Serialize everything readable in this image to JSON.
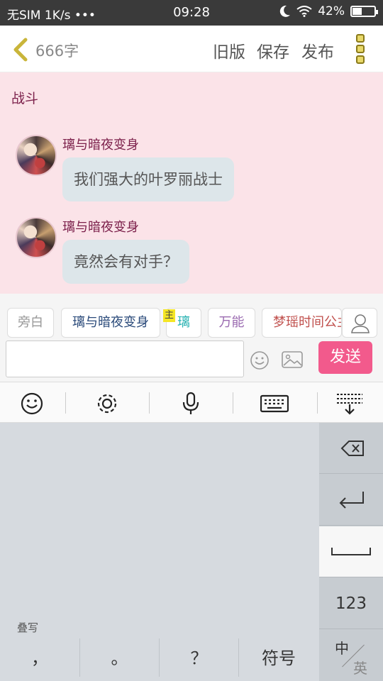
{
  "status_bar": {
    "carrier": "无SIM 1K/s •••",
    "time": "09:28",
    "battery_percent": "42%",
    "battery_level": 0.42
  },
  "header": {
    "word_count": "666字",
    "old_version": "旧版",
    "save": "保存",
    "publish": "发布"
  },
  "content": {
    "title": "战斗",
    "messages": [
      {
        "name": "璃与暗夜变身",
        "text": "我们强大的叶罗丽战士"
      },
      {
        "name": "璃与暗夜变身",
        "text": "竟然会有对手？"
      }
    ]
  },
  "roles": [
    {
      "label": "旁白",
      "color": "#999999"
    },
    {
      "label": "璃与暗夜变身",
      "color": "#2a4a7a"
    },
    {
      "label": "璃",
      "color": "#2ab3b3",
      "badge": "主"
    },
    {
      "label": "万能",
      "color": "#9a6ab0"
    },
    {
      "label": "梦瑶时间公主",
      "color": "#c0504d"
    }
  ],
  "composer": {
    "input_value": "",
    "send": "发送"
  },
  "keyboard": {
    "mode_label": "叠写",
    "bottom_keys": [
      "，",
      "。",
      "？",
      "符号"
    ],
    "number_key": "123",
    "lang_primary": "中",
    "lang_secondary": "英"
  },
  "colors": {
    "accent_pink": "#f25a8c",
    "content_bg": "#fbe3e8",
    "name_color": "#7b1f4a"
  }
}
